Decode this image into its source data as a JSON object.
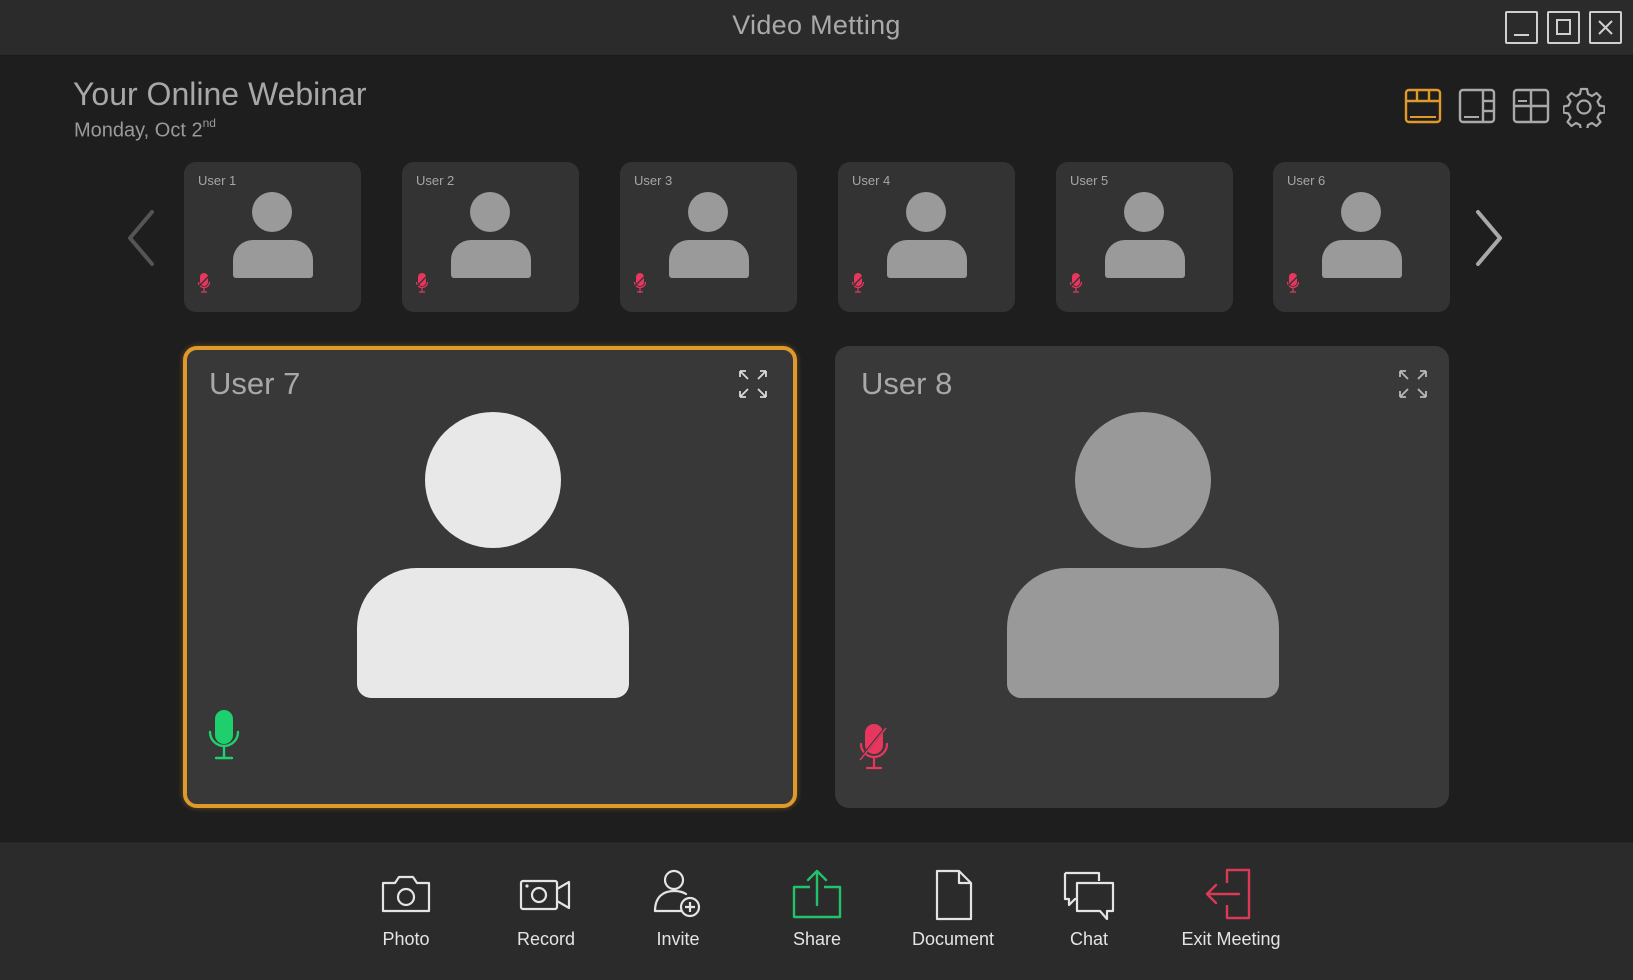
{
  "window": {
    "title": "Video Metting",
    "controls": [
      "minimize",
      "maximize",
      "close"
    ]
  },
  "header": {
    "title": "Your Online Webinar",
    "date_main": "Monday, Oct 2",
    "date_suffix": "nd"
  },
  "view_options": {
    "selected": "filmstrip-layout",
    "items": [
      {
        "name": "filmstrip-layout-icon",
        "active": true
      },
      {
        "name": "sidebar-layout-icon",
        "active": false
      },
      {
        "name": "grid-layout-icon",
        "active": false
      },
      {
        "name": "settings-icon",
        "active": false
      }
    ]
  },
  "thumbnails": [
    {
      "label": "User 1",
      "mic": "muted"
    },
    {
      "label": "User 2",
      "mic": "muted"
    },
    {
      "label": "User 3",
      "mic": "muted"
    },
    {
      "label": "User 4",
      "mic": "muted"
    },
    {
      "label": "User 5",
      "mic": "muted"
    },
    {
      "label": "User 6",
      "mic": "muted"
    }
  ],
  "main_tiles": [
    {
      "label": "User 7",
      "mic": "active",
      "highlighted": true
    },
    {
      "label": "User 8",
      "mic": "muted",
      "highlighted": false
    }
  ],
  "toolbar": {
    "items": [
      {
        "label": "Photo",
        "icon": "camera-icon"
      },
      {
        "label": "Record",
        "icon": "video-camera-icon"
      },
      {
        "label": "Invite",
        "icon": "add-user-icon"
      },
      {
        "label": "Share",
        "icon": "share-icon"
      },
      {
        "label": "Document",
        "icon": "document-icon"
      },
      {
        "label": "Chat",
        "icon": "chat-icon"
      },
      {
        "label": "Exit Meeting",
        "icon": "exit-icon"
      }
    ]
  },
  "colors": {
    "accent": "#e09a2c",
    "mic_active": "#1fcf6e",
    "mic_muted": "#e8375e",
    "share": "#22c26a",
    "exit": "#d93a55"
  }
}
